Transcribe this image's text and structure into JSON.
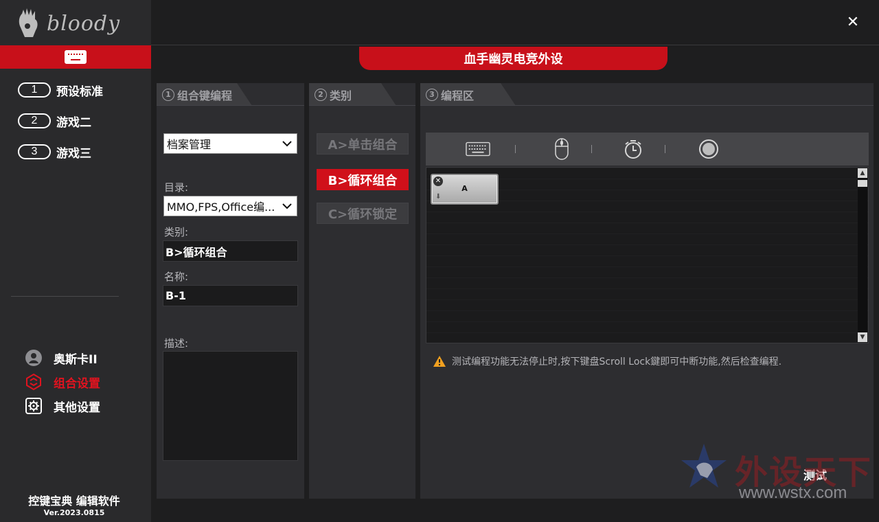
{
  "app": {
    "logo_text": "bloody",
    "close_label": "✕",
    "title_tab": "血手幽灵电竞外设"
  },
  "sidebar": {
    "profiles": [
      {
        "num": "1",
        "label": "预设标准"
      },
      {
        "num": "2",
        "label": "游戏二"
      },
      {
        "num": "3",
        "label": "游戏三"
      }
    ],
    "nav": [
      {
        "label": "奥斯卡II",
        "icon": "oscar-avatar-icon",
        "active": false
      },
      {
        "label": "组合设置",
        "icon": "combo-settings-icon",
        "active": true
      },
      {
        "label": "其他设置",
        "icon": "gear-icon",
        "active": false
      }
    ],
    "footer_title": "控键宝典 编辑软件",
    "footer_version": "Ver.2023.0815",
    "accent_color": "#c8101a"
  },
  "panel1": {
    "num": "①",
    "title": "组合键编程",
    "profile_select": "档案管理",
    "dir_label": "目录:",
    "dir_select": "MMO,FPS,Office编...",
    "category_label": "类别:",
    "category_value": "B>循环组合",
    "name_label": "名称:",
    "name_value": "B-1",
    "desc_label": "描述:"
  },
  "panel2": {
    "num": "②",
    "title": "类别",
    "buttons": [
      {
        "label": "A>单击组合",
        "active": false
      },
      {
        "label": "B>循环组合",
        "active": true
      },
      {
        "label": "C>循环锁定",
        "active": false
      }
    ]
  },
  "panel3": {
    "num": "③",
    "title": "编程区",
    "tools": [
      "keyboard-icon",
      "mouse-icon",
      "timer-icon",
      "record-icon"
    ],
    "key_block_label": "A",
    "warning_text": "测试编程功能无法停止时,按下键盘Scroll Lock鍵即可中断功能,然后检查编程.",
    "test_label": "测试"
  },
  "watermark": {
    "text": "外设天下",
    "url": "www.wstx.com"
  }
}
